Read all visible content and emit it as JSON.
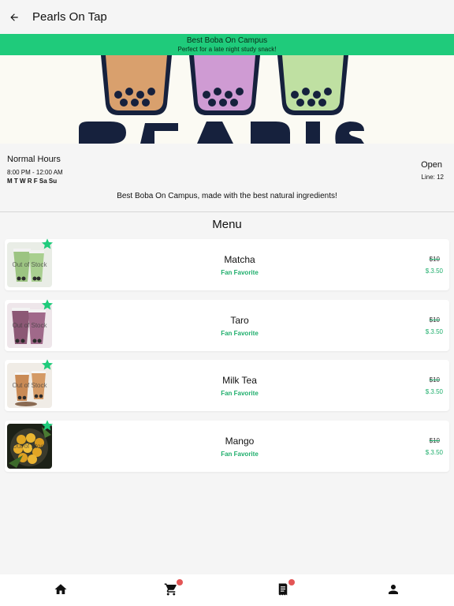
{
  "app": {
    "title": "Pearls On Tap"
  },
  "promo": {
    "title": "Best Boba On Campus",
    "subtitle": "Perfect for a late night study snack!"
  },
  "hours": {
    "title": "Normal Hours",
    "time": "8:00 PM - 12:00 AM",
    "days": "M T W R F Sa Su",
    "status": "Open",
    "line": "Line: 12"
  },
  "description": "Best Boba On Campus, made with the best natural ingredients!",
  "menu": {
    "heading": "Menu",
    "items": [
      {
        "name": "Matcha",
        "badge": "Fan Favorite",
        "old_price": "$10",
        "price": "$.3.50",
        "overlay": "Out of Stock"
      },
      {
        "name": "Taro",
        "badge": "Fan Favorite",
        "old_price": "$10",
        "price": "$.3.50",
        "overlay": "Out of Stock"
      },
      {
        "name": "Milk Tea",
        "badge": "Fan Favorite",
        "old_price": "$10",
        "price": "$.3.50",
        "overlay": "Out of Stock"
      },
      {
        "name": "Mango",
        "badge": "Fan Favorite",
        "old_price": "$10",
        "price": "$.3.50",
        "overlay": "Out of Stock"
      }
    ]
  },
  "nav": {
    "items": [
      {
        "icon": "home-icon"
      },
      {
        "icon": "cart-icon",
        "badge": true
      },
      {
        "icon": "receipt-icon",
        "badge": true
      },
      {
        "icon": "person-icon"
      }
    ]
  },
  "colors": {
    "accent": "#1fcb7b",
    "accent_text": "#1fae6c",
    "notification": "#e35555"
  }
}
